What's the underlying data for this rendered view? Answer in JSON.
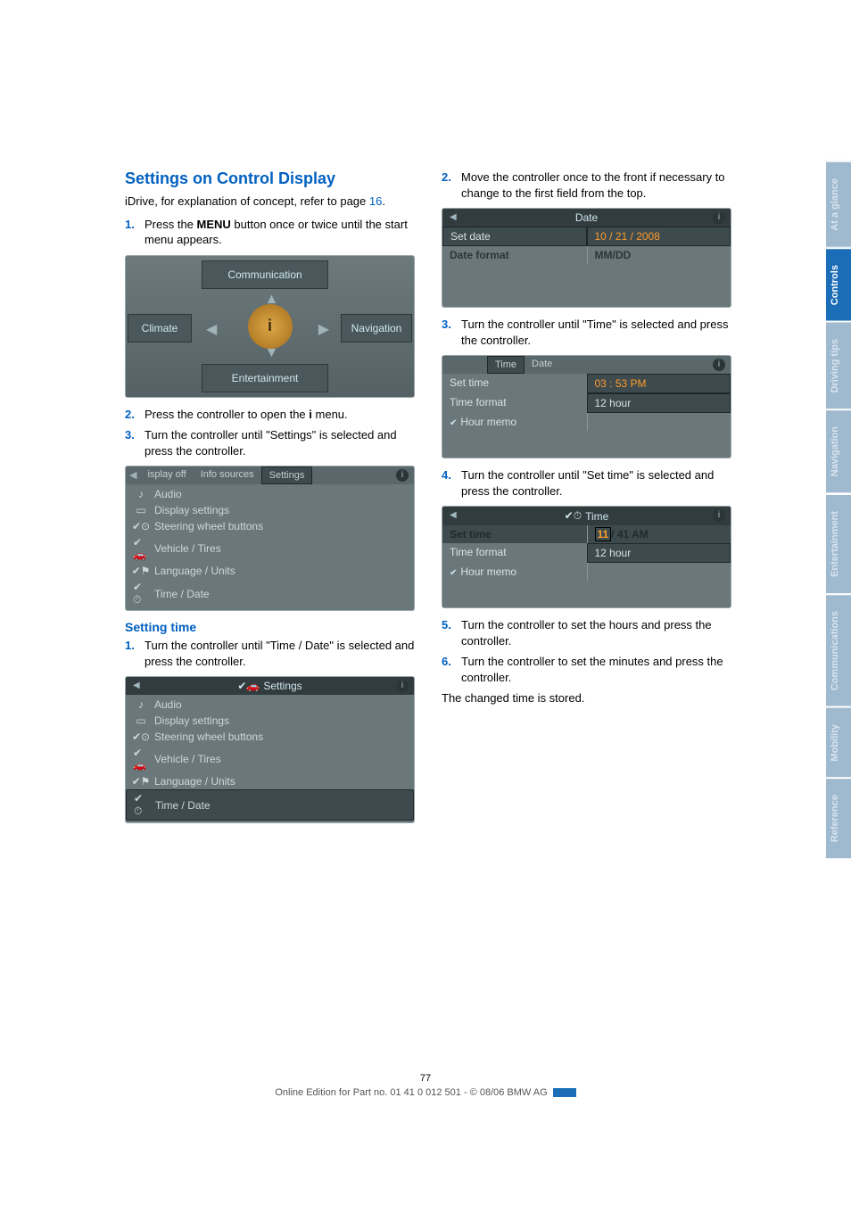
{
  "heading": "Settings on Control Display",
  "intro_prefix": "iDrive, for explanation of concept, refer to page ",
  "intro_link": "16",
  "intro_suffix": ".",
  "left": {
    "step1_prefix": "Press the ",
    "step1_bold": "MENU",
    "step1_suffix": " button once or twice until the start menu appears.",
    "cross": {
      "top": "Communication",
      "left": "Climate",
      "right": "Navigation",
      "bottom": "Entertainment",
      "center_glyph": "i"
    },
    "step2_prefix": "Press the controller to open the ",
    "step2_icon_label": "i",
    "step2_suffix": " menu.",
    "step3": "Turn the controller until \"Settings\" is selected and press the controller.",
    "shot_settings_tabs": {
      "tabs": [
        "isplay off",
        "Info sources",
        "Settings"
      ],
      "items": [
        {
          "icon": "audio-icon",
          "label": "Audio"
        },
        {
          "icon": "display-icon",
          "label": "Display settings"
        },
        {
          "icon": "steering-icon",
          "label": "Steering wheel buttons"
        },
        {
          "icon": "vehicle-icon",
          "label": "Vehicle / Tires"
        },
        {
          "icon": "language-icon",
          "label": "Language / Units"
        },
        {
          "icon": "clock-icon",
          "label": "Time / Date"
        }
      ]
    },
    "setting_time_heading": "Setting time",
    "st_step1": "Turn the controller until \"Time / Date\" is selected and press the controller.",
    "shot_settings_selected": {
      "title": "Settings",
      "items": [
        {
          "icon": "audio-icon",
          "label": "Audio"
        },
        {
          "icon": "display-icon",
          "label": "Display settings"
        },
        {
          "icon": "steering-icon",
          "label": "Steering wheel buttons"
        },
        {
          "icon": "vehicle-icon",
          "label": "Vehicle / Tires"
        },
        {
          "icon": "language-icon",
          "label": "Language / Units"
        },
        {
          "icon": "clock-icon",
          "label": "Time / Date"
        }
      ]
    }
  },
  "right": {
    "step2": "Move the controller once to the front if necessary to change to the first field from the top.",
    "shot_date": {
      "title": "Date",
      "rows": [
        {
          "l": "Set date",
          "r": "10 / 21 / 2008"
        },
        {
          "l": "Date format",
          "r": "MM/DD"
        }
      ]
    },
    "step3": "Turn the controller until \"Time\" is selected and press the controller.",
    "shot_time_tab": {
      "tabs": [
        "Time",
        "Date"
      ],
      "rows": [
        {
          "l": "Set time",
          "r": "03 : 53 PM"
        },
        {
          "l": "Time format",
          "r": "12 hour"
        },
        {
          "l": "Hour memo",
          "r": ""
        }
      ]
    },
    "step4": "Turn the controller until \"Set time\" is selected and press the controller.",
    "shot_set_time": {
      "title": "Time",
      "rows": [
        {
          "l": "Set time",
          "r_hl": "11",
          "r_rest": "/ 41 AM"
        },
        {
          "l": "Time format",
          "r": "12 hour"
        },
        {
          "l": "Hour memo",
          "r": ""
        }
      ]
    },
    "step5": "Turn the controller to set the hours and press the controller.",
    "step6": "Turn the controller to set the minutes and press the controller.",
    "stored": "The changed time is stored."
  },
  "thumb_tabs": [
    "At a glance",
    "Controls",
    "Driving tips",
    "Navigation",
    "Entertainment",
    "Communications",
    "Mobility",
    "Reference"
  ],
  "active_thumb": "Controls",
  "footer": {
    "page": "77",
    "line": "Online Edition for Part no. 01 41 0 012 501 - © 08/06 BMW AG"
  },
  "step_nums": {
    "n1": "1.",
    "n2": "2.",
    "n3": "3.",
    "n4": "4.",
    "n5": "5.",
    "n6": "6."
  }
}
